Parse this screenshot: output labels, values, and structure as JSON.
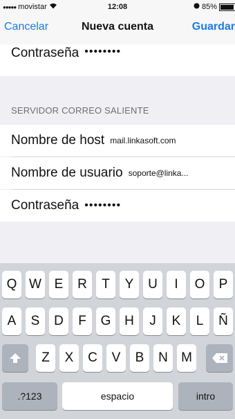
{
  "status_bar": {
    "carrier": "movistar",
    "time": "12:08",
    "battery": "85%",
    "battery_level": 0.85
  },
  "navbar": {
    "cancel_label": "Cancelar",
    "title": "Nueva cuenta",
    "save_label": "Guardar"
  },
  "incoming": {
    "password_label": "Contraseña",
    "password_value": "••••••••"
  },
  "outgoing": {
    "section_title": "SERVIDOR CORREO SALIENTE",
    "host_label": "Nombre de host",
    "host_value": "mail.linkasoft.com",
    "user_label": "Nombre de usuario",
    "user_value": "soporte@linka...",
    "password_label": "Contraseña",
    "password_value": "••••••••"
  },
  "keyboard": {
    "row1": [
      "Q",
      "W",
      "E",
      "R",
      "T",
      "Y",
      "U",
      "I",
      "O",
      "P"
    ],
    "row2": [
      "A",
      "S",
      "D",
      "F",
      "G",
      "H",
      "J",
      "K",
      "L",
      "Ñ"
    ],
    "row3": [
      "Z",
      "X",
      "C",
      "V",
      "B",
      "N",
      "M"
    ],
    "numbers_label": ".?123",
    "space_label": "espacio",
    "return_label": "intro"
  },
  "colors": {
    "accent": "#1a7af0",
    "background": "#efeff4",
    "keyboard": "#d1d4d9"
  }
}
